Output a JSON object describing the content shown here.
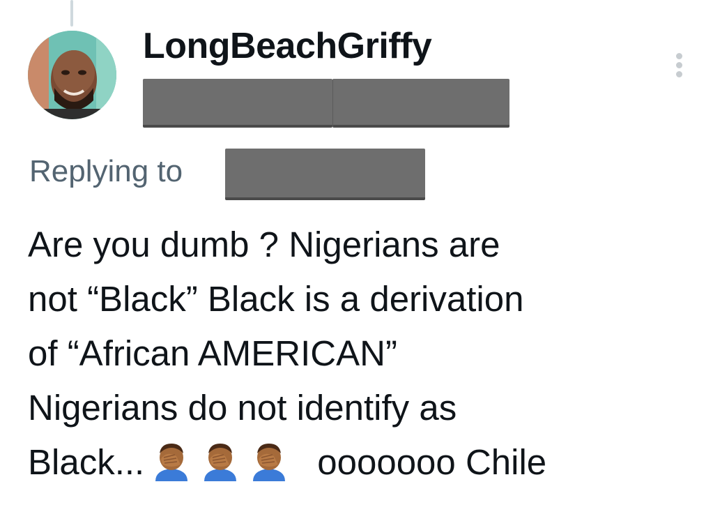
{
  "tweet": {
    "display_name": "LongBeachGriffy",
    "replying_to_label": "Replying to",
    "lines": [
      "Are you dumb ? Nigerians are",
      "not “Black” Black is a derivation",
      "of “African AMERICAN”",
      "Nigerians do not identify as"
    ],
    "last_line_start": "Black...",
    "last_line_end": "ooooooo Chile",
    "emojis": [
      "facepalm-emoji",
      "facepalm-emoji",
      "facepalm-emoji"
    ],
    "redactions": [
      "handle-redacted",
      "reply-target-redacted"
    ]
  },
  "icons": {
    "more": "more-vertical-icon"
  },
  "colors": {
    "text": "#0f1419",
    "secondary": "#536471",
    "redaction": "#6e6e6e",
    "thread_line": "#cfd9de"
  }
}
